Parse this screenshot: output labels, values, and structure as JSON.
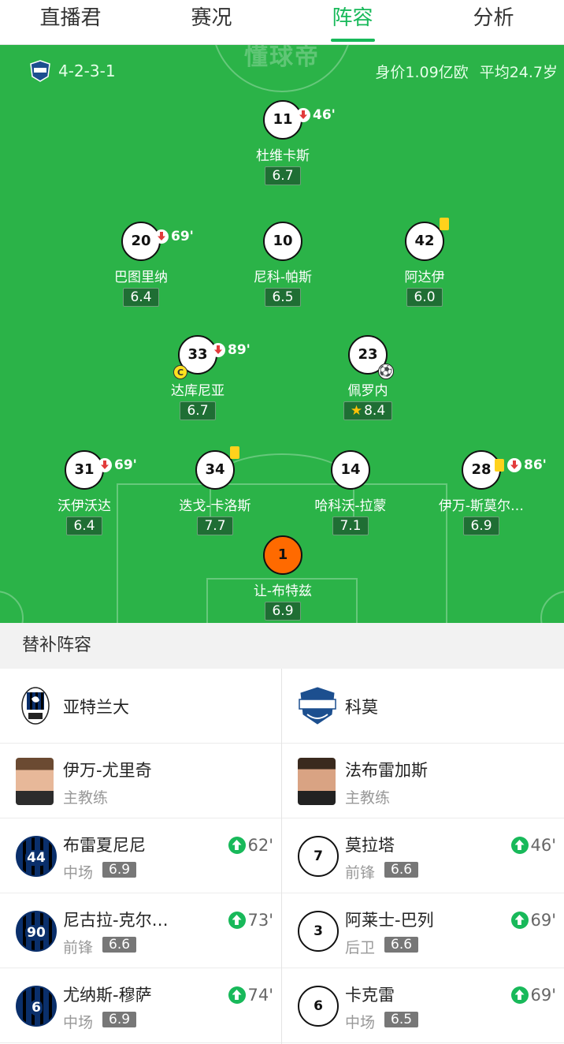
{
  "tabs": [
    "直播君",
    "赛况",
    "阵容",
    "分析"
  ],
  "watermark": "懂球帝",
  "pitch": {
    "formation": "4-2-3-1",
    "market_value": "身价1.09亿欧",
    "avg_age": "平均24.7岁"
  },
  "players": [
    {
      "num": "11",
      "name": "杜维卡斯",
      "rating": "6.7",
      "sub_min": "46'"
    },
    {
      "num": "20",
      "name": "巴图里纳",
      "rating": "6.4",
      "sub_min": "69'"
    },
    {
      "num": "10",
      "name": "尼科-帕斯",
      "rating": "6.5"
    },
    {
      "num": "42",
      "name": "阿达伊",
      "rating": "6.0"
    },
    {
      "num": "33",
      "name": "达库尼亚",
      "rating": "6.7",
      "sub_min": "89'",
      "captain": "C"
    },
    {
      "num": "23",
      "name": "佩罗内",
      "rating": "8.4"
    },
    {
      "num": "31",
      "name": "沃伊沃达",
      "rating": "6.4",
      "sub_min": "69'"
    },
    {
      "num": "34",
      "name": "迭戈-卡洛斯",
      "rating": "7.7"
    },
    {
      "num": "14",
      "name": "哈科沃-拉蒙",
      "rating": "7.1"
    },
    {
      "num": "28",
      "name": "伊万-斯莫尔…",
      "rating": "6.9",
      "sub_min": "86'"
    },
    {
      "num": "1",
      "name": "让-布特兹",
      "rating": "6.9"
    }
  ],
  "subs": {
    "header": "替补阵容",
    "home": {
      "team": "亚特兰大",
      "coach": {
        "name": "伊万-尤里奇",
        "role": "主教练"
      },
      "players": [
        {
          "num": "44",
          "name": "布雷夏尼尼",
          "pos": "中场",
          "rating": "6.9",
          "in": "62'"
        },
        {
          "num": "90",
          "name": "尼古拉-克尔…",
          "pos": "前锋",
          "rating": "6.6",
          "in": "73'"
        },
        {
          "num": "6",
          "name": "尤纳斯-穆萨",
          "pos": "中场",
          "rating": "6.9",
          "in": "74'"
        }
      ]
    },
    "away": {
      "team": "科莫",
      "coach": {
        "name": "法布雷加斯",
        "role": "主教练"
      },
      "players": [
        {
          "num": "7",
          "name": "莫拉塔",
          "pos": "前锋",
          "rating": "6.6",
          "in": "46'"
        },
        {
          "num": "3",
          "name": "阿莱士-巴列",
          "pos": "后卫",
          "rating": "6.6",
          "in": "69'"
        },
        {
          "num": "6",
          "name": "卡克雷",
          "pos": "中场",
          "rating": "6.5",
          "in": "69'"
        }
      ]
    }
  }
}
